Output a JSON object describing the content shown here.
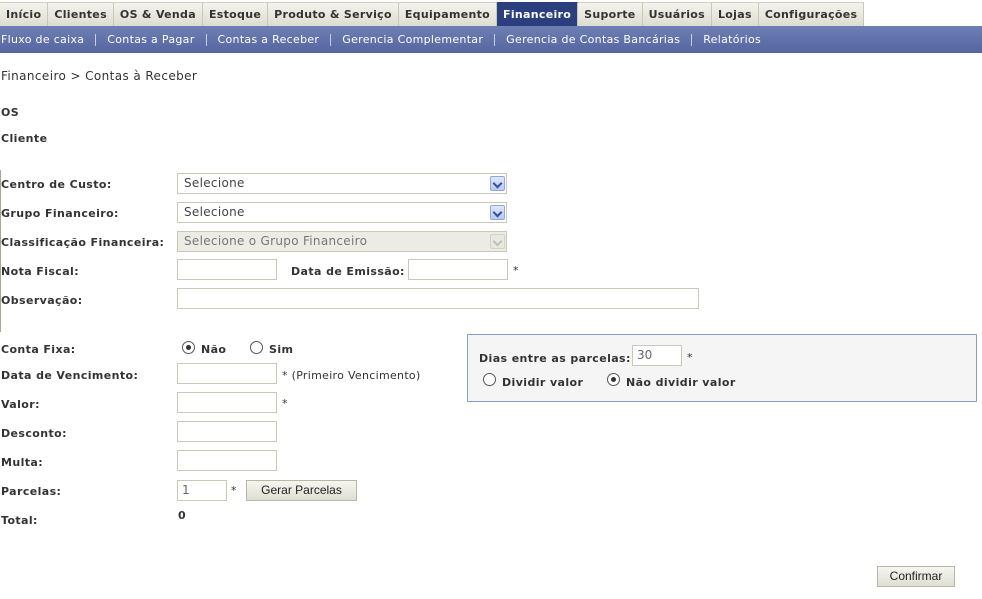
{
  "topnav": {
    "tabs": [
      {
        "label": "Início",
        "active": false
      },
      {
        "label": "Clientes",
        "active": false
      },
      {
        "label": "OS & Venda",
        "active": false
      },
      {
        "label": "Estoque",
        "active": false
      },
      {
        "label": "Produto & Serviço",
        "active": false
      },
      {
        "label": "Equipamento",
        "active": false
      },
      {
        "label": "Financeiro",
        "active": true
      },
      {
        "label": "Suporte",
        "active": false
      },
      {
        "label": "Usuários",
        "active": false
      },
      {
        "label": "Lojas",
        "active": false
      },
      {
        "label": "Configurações",
        "active": false
      }
    ],
    "active_color": "#2b3f7f"
  },
  "subnav": {
    "items": [
      "Fluxo de caixa",
      "Contas a Pagar",
      "Contas a Receber",
      "Gerencia Complementar",
      "Gerencia de Contas Bancárias",
      "Relatórios"
    ],
    "color": "#5f70aa"
  },
  "breadcrumb": "Financeiro > Contas à Receber",
  "info": {
    "os_label": "OS",
    "cliente_label": "Cliente"
  },
  "form": {
    "centro_custo": {
      "label": "Centro de Custo:",
      "value": "Selecione"
    },
    "grupo_financeiro": {
      "label": "Grupo Financeiro:",
      "value": "Selecione"
    },
    "classificacao": {
      "label": "Classificação Financeira:",
      "value": "Selecione o Grupo Financeiro"
    },
    "nota_fiscal": {
      "label": "Nota Fiscal:",
      "value": ""
    },
    "data_emissao": {
      "label": "Data de Emissão:",
      "value": "",
      "required": "*"
    },
    "observacao": {
      "label": "Observação:",
      "value": ""
    },
    "conta_fixa": {
      "label": "Conta Fixa:",
      "options": [
        "Não",
        "Sim"
      ],
      "selected": "Não"
    },
    "data_vencimento": {
      "label": "Data de Vencimento:",
      "value": "",
      "hint": "* (Primeiro Vencimento)"
    },
    "valor": {
      "label": "Valor:",
      "value": "",
      "required": "*"
    },
    "desconto": {
      "label": "Desconto:",
      "value": ""
    },
    "multa": {
      "label": "Multa:",
      "value": ""
    },
    "parcelas": {
      "label": "Parcelas:",
      "value": "1",
      "required": "*",
      "button": "Gerar Parcelas"
    },
    "total": {
      "label": "Total:",
      "value": "0"
    }
  },
  "panel": {
    "dias_label": "Dias entre as parcelas:",
    "dias_value": "30",
    "required": "*",
    "options": [
      "Dividir valor",
      "Não dividir valor"
    ],
    "selected": "Não dividir valor"
  },
  "confirm_button": "Confirmar"
}
